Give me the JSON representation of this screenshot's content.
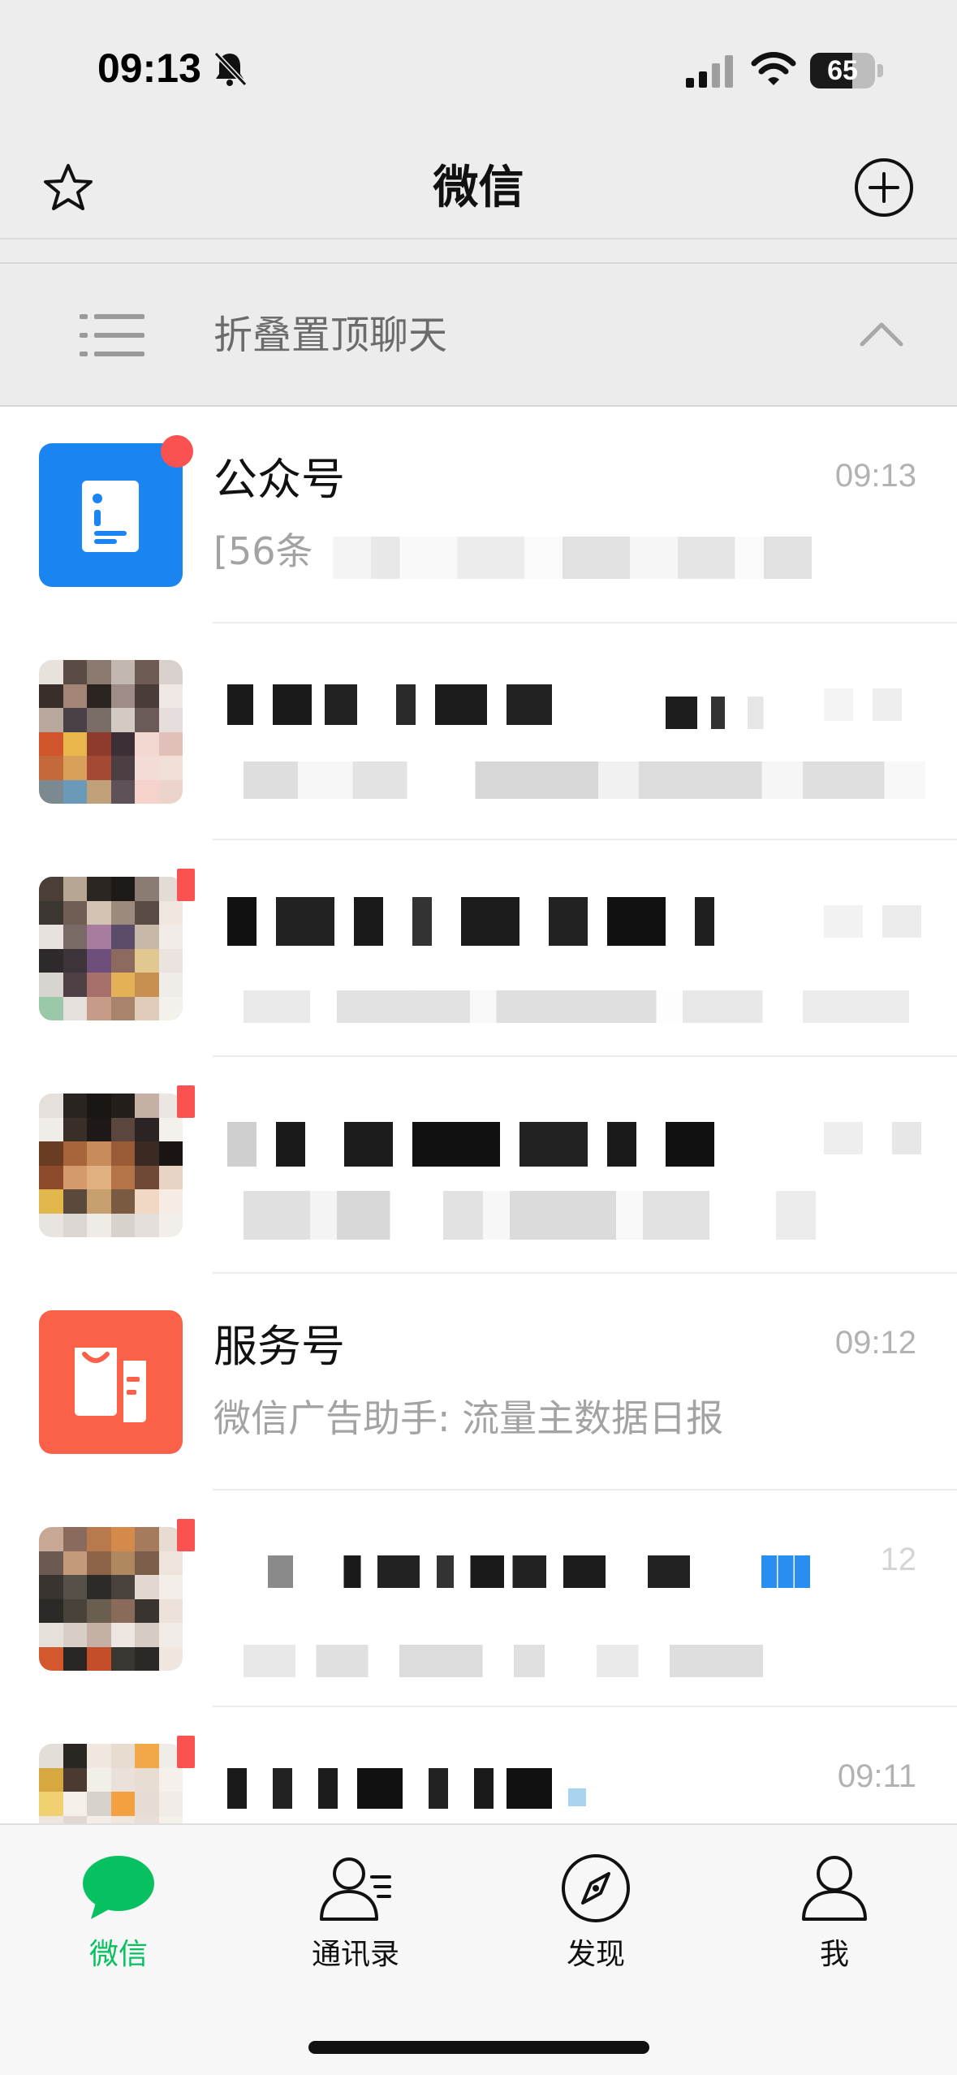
{
  "status_bar": {
    "time": "09:13",
    "battery_label": "65",
    "battery_level_percent": 65,
    "icons": [
      "bell-off-icon",
      "signal-icon",
      "wifi-icon",
      "battery-icon"
    ]
  },
  "nav": {
    "title": "微信",
    "left_icon": "star-icon",
    "right_icon": "add-circle-icon"
  },
  "pinned": {
    "label": "折叠置顶聊天",
    "icon": "list-icon",
    "chevron_icon": "chevron-up-icon"
  },
  "chats": [
    {
      "name": "公众号",
      "time": "09:13",
      "preview": "[56条",
      "avatar": "official-account-icon",
      "avatar_color": "#1a85f0",
      "unread": true
    },
    {
      "name": "",
      "time": "",
      "preview": "",
      "avatar": "pixelated-avatar",
      "unread": false
    },
    {
      "name": "",
      "time": "",
      "preview": "",
      "avatar": "pixelated-avatar",
      "unread": true
    },
    {
      "name": "",
      "time": "",
      "preview": "",
      "avatar": "pixelated-avatar",
      "unread": true
    },
    {
      "name": "服务号",
      "time": "09:12",
      "preview": "微信广告助手: 流量主数据日报",
      "avatar": "service-account-icon",
      "avatar_color": "#fa6148",
      "unread": false
    },
    {
      "name": "",
      "time": "12",
      "preview": "",
      "avatar": "pixelated-avatar",
      "unread": true
    },
    {
      "name": "",
      "time": "09:11",
      "preview": "",
      "avatar": "pixelated-avatar",
      "unread": true
    }
  ],
  "tabs": [
    {
      "label": "微信",
      "icon": "chat-bubble-icon",
      "active": true
    },
    {
      "label": "通讯录",
      "icon": "contacts-icon",
      "active": false
    },
    {
      "label": "发现",
      "icon": "compass-icon",
      "active": false
    },
    {
      "label": "我",
      "icon": "person-icon",
      "active": false
    }
  ],
  "colors": {
    "accent_green": "#07c160",
    "badge_red": "#fa5151",
    "background_gray": "#ededed"
  }
}
